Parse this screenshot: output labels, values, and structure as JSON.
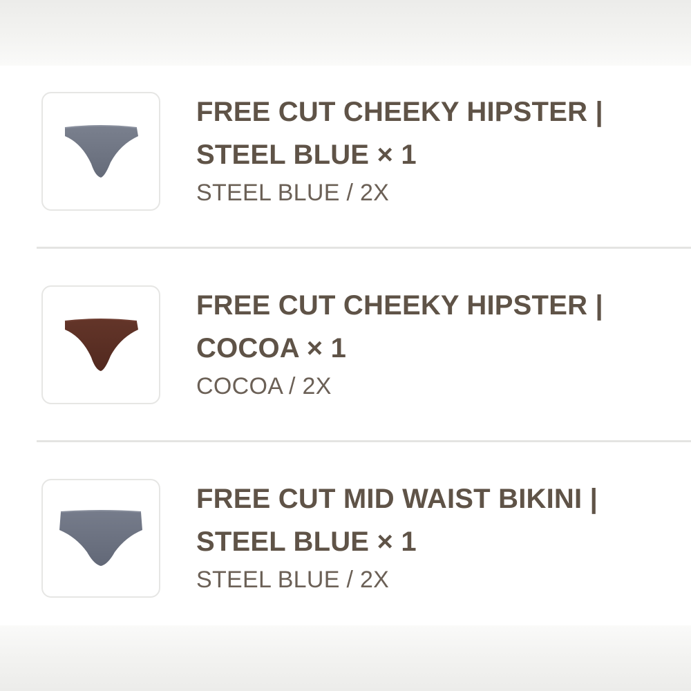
{
  "order_items": [
    {
      "title_line1": "FREE CUT CHEEKY HIPSTER |",
      "title_line2": "STEEL BLUE × 1",
      "variant": "STEEL BLUE / 2X",
      "image": {
        "icon": "underwear-cheeky-hipster-icon",
        "color": "#6f7583"
      }
    },
    {
      "title_line1": "FREE CUT CHEEKY HIPSTER |",
      "title_line2": "COCOA × 1",
      "variant": "COCOA / 2X",
      "image": {
        "icon": "underwear-cheeky-hipster-icon",
        "color": "#5c2f26"
      }
    },
    {
      "title_line1": "FREE CUT MID WAIST BIKINI |",
      "title_line2": "STEEL BLUE × 1",
      "variant": "STEEL BLUE / 2X",
      "image": {
        "icon": "underwear-mid-waist-bikini-icon",
        "color": "#6c7282"
      }
    }
  ],
  "colors": {
    "title_text": "#5f5347",
    "variant_text": "#6b6056",
    "divider": "#e4e4e2"
  }
}
